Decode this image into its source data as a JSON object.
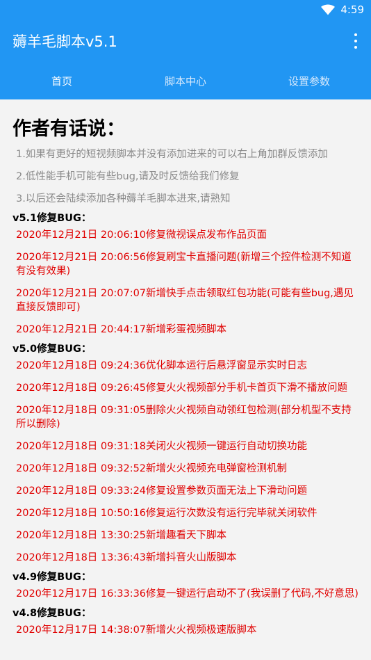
{
  "status_bar": {
    "time": "4:59"
  },
  "app_bar": {
    "title": "薅羊毛脚本v5.1"
  },
  "tabs": [
    {
      "label": "首页"
    },
    {
      "label": "脚本中心"
    },
    {
      "label": "设置参数"
    }
  ],
  "content": {
    "heading": "作者有话说：",
    "notes": [
      "1.如果有更好的短视频脚本并没有添加进来的可以右上角加群反馈添加",
      "2.低性能手机可能有些bug,请及时反馈给我们修复",
      "3.以后还会陆续添加各种薅羊毛脚本进来,请熟知"
    ],
    "sections": [
      {
        "title": "v5.1修复BUG：",
        "entries": [
          "2020年12月21日 20:06:10修复微视误点发布作品页面",
          "2020年12月21日 20:06:56修复刷宝卡直播问题(新增三个控件检测不知道有没有效果)",
          "2020年12月21日 20:07:07新增快手点击领取红包功能(可能有些bug,遇见直接反馈即可)",
          "2020年12月21日 20:44:17新增彩蛋视频脚本"
        ]
      },
      {
        "title": "v5.0修复BUG：",
        "entries": [
          "2020年12月18日 09:24:36优化脚本运行后悬浮窗显示实时日志",
          "2020年12月18日 09:26:45修复火火视频部分手机卡首页下滑不播放问题",
          "2020年12月18日 09:31:05删除火火视频自动领红包检测(部分机型不支持所以删除)",
          "2020年12月18日 09:31:18关闭火火视频一键运行自动切换功能",
          "2020年12月18日 09:32:52新增火火视频充电弹窗检测机制",
          "2020年12月18日 09:33:24修复设置参数页面无法上下滑动问题",
          "2020年12月18日 10:50:16修复运行次数没有运行完毕就关闭软件",
          "2020年12月18日 13:30:25新增趣看天下脚本",
          "2020年12月18日 13:36:43新增抖音火山版脚本"
        ]
      },
      {
        "title": "v4.9修复BUG：",
        "entries": [
          "2020年12月17日 16:33:36修复一键运行启动不了(我误删了代码,不好意思)"
        ]
      },
      {
        "title": "v4.8修复BUG：",
        "entries": [
          "2020年12月17日 14:38:07新增火火视频极速版脚本"
        ]
      }
    ]
  }
}
